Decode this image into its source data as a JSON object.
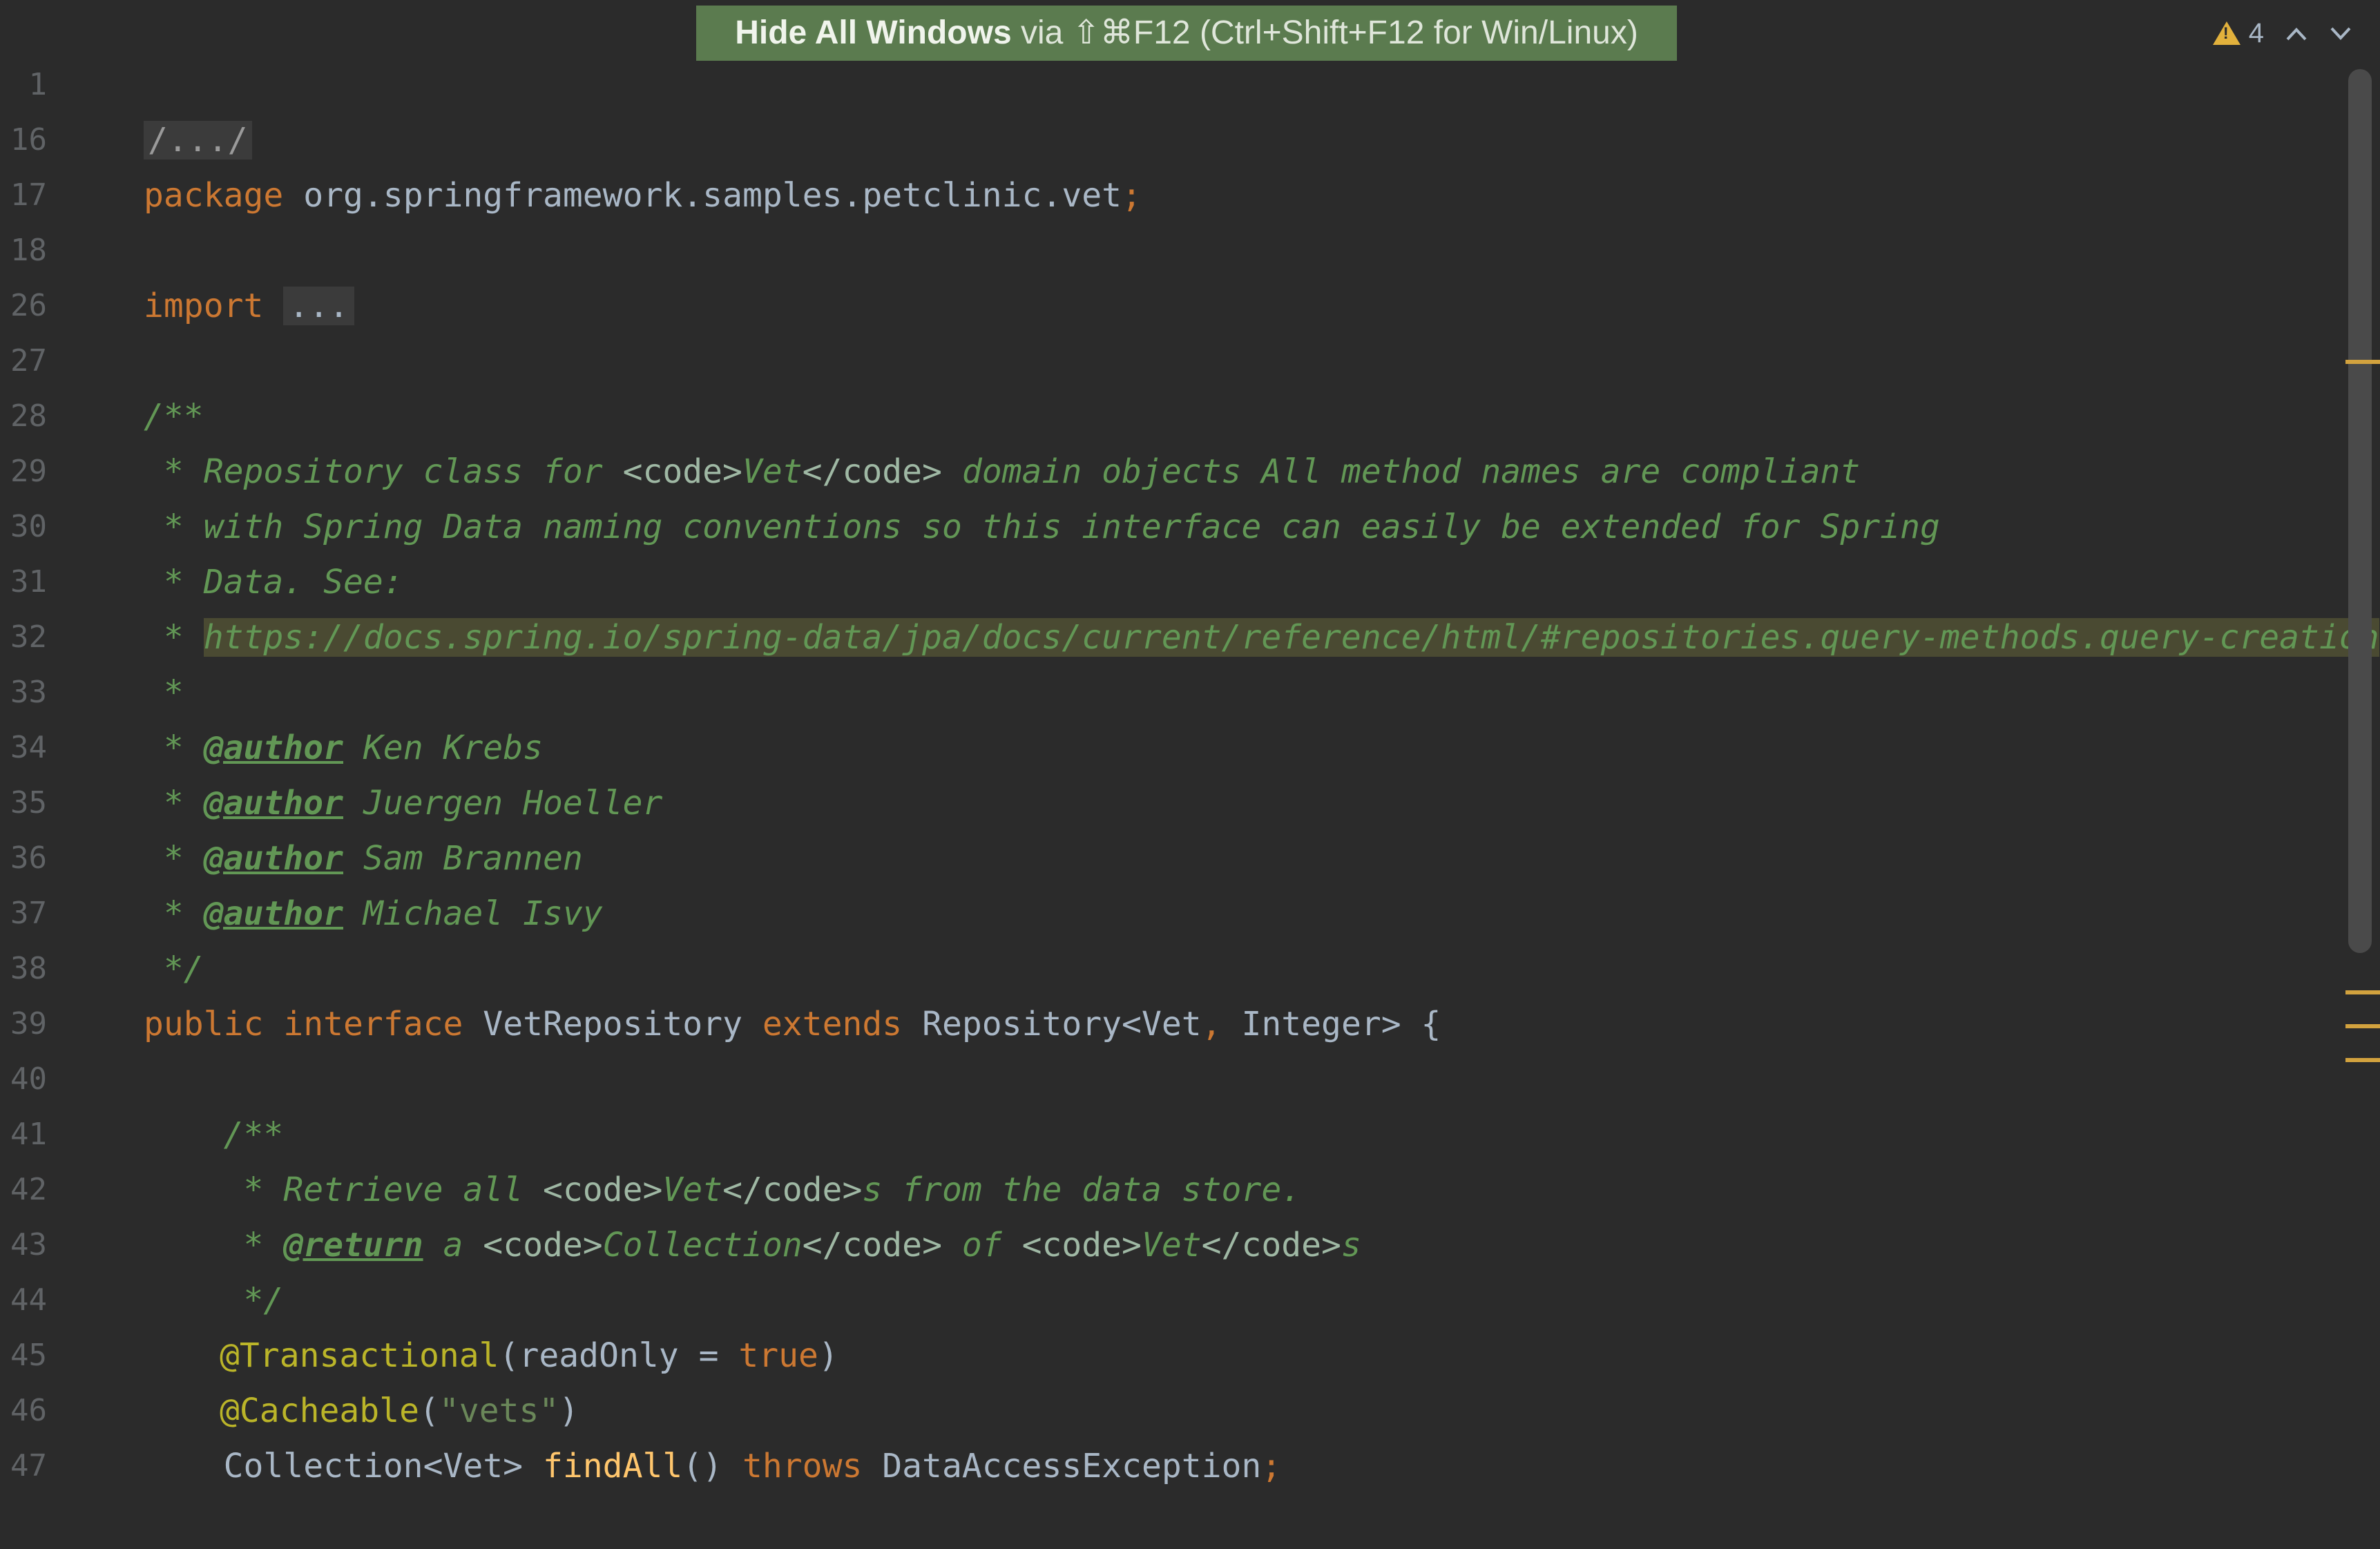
{
  "tooltip": {
    "action": "Hide All Windows",
    "via": " via ⇧⌘F12 (Ctrl+Shift+F12 for Win/Linux)"
  },
  "inspections": {
    "warning_count": "4",
    "warning_icon": "warning-triangle-icon",
    "up_icon": "chevron-up-icon",
    "down_icon": "chevron-down-icon"
  },
  "lines": {
    "l1": {
      "num": "1",
      "fold": "/.../"
    },
    "l16": {
      "num": "16",
      "kw": "package",
      "rest": " org.springframework.samples.petclinic.vet",
      "semi": ";"
    },
    "l17": {
      "num": "17"
    },
    "l18": {
      "num": "18",
      "kw": "import",
      "fold": "..."
    },
    "l26": {
      "num": "26"
    },
    "l27": {
      "num": "27",
      "text": "/**"
    },
    "l28": {
      "num": "28",
      "a": " * Repository class for ",
      "t1": "<code>",
      "b": "Vet",
      "t2": "</code>",
      "c": " domain objects All method names are compliant"
    },
    "l29": {
      "num": "29",
      "text": " * with Spring Data naming conventions so this interface can easily be extended for Spring"
    },
    "l30": {
      "num": "30",
      "text": " * Data. See:"
    },
    "l31": {
      "num": "31",
      "a": " * ",
      "link": "https://docs.spring.io/spring-data/jpa/docs/current/reference/html/#repositories.query-methods.query-creation"
    },
    "l32": {
      "num": "32",
      "text": " *"
    },
    "l33": {
      "num": "33",
      "a": " * ",
      "tag": "@author",
      "b": " Ken Krebs"
    },
    "l34": {
      "num": "34",
      "a": " * ",
      "tag": "@author",
      "b": " Juergen Hoeller"
    },
    "l35": {
      "num": "35",
      "a": " * ",
      "tag": "@author",
      "b": " Sam Brannen"
    },
    "l36": {
      "num": "36",
      "a": " * ",
      "tag": "@author",
      "b": " Michael Isvy"
    },
    "l37": {
      "num": "37",
      "text": " */"
    },
    "l38": {
      "num": "38",
      "k1": "public",
      "k2": "interface",
      "name": " VetRepository ",
      "k3": "extends",
      "b": " Repository<Vet",
      "comma": ",",
      "c": " Integer> {"
    },
    "l39": {
      "num": "39"
    },
    "l40": {
      "num": "40",
      "text": "    /**"
    },
    "l41": {
      "num": "41",
      "a": "     * Retrieve all ",
      "t1": "<code>",
      "b": "Vet",
      "t2": "</code>",
      "c": "s from the data store."
    },
    "l42": {
      "num": "42",
      "a": "     * ",
      "tag": "@return",
      "b": " a ",
      "t1": "<code>",
      "c": "Collection",
      "t2": "</code>",
      "d": " of ",
      "t3": "<code>",
      "e": "Vet",
      "t4": "</code>",
      "f": "s"
    },
    "l43": {
      "num": "43",
      "text": "     */"
    },
    "l44": {
      "num": "44",
      "ann": "@Transactional",
      "a": "(readOnly = ",
      "kw": "true",
      "b": ")"
    },
    "l45": {
      "num": "45",
      "ann": "@Cacheable",
      "a": "(",
      "str": "\"vets\"",
      "b": ")"
    },
    "l46": {
      "num": "46",
      "a": "    Collection<Vet> ",
      "fn": "findAll",
      "b": "() ",
      "kw": "throws",
      "c": " DataAccessException",
      "semi": ";"
    },
    "l47": {
      "num": "47"
    }
  }
}
